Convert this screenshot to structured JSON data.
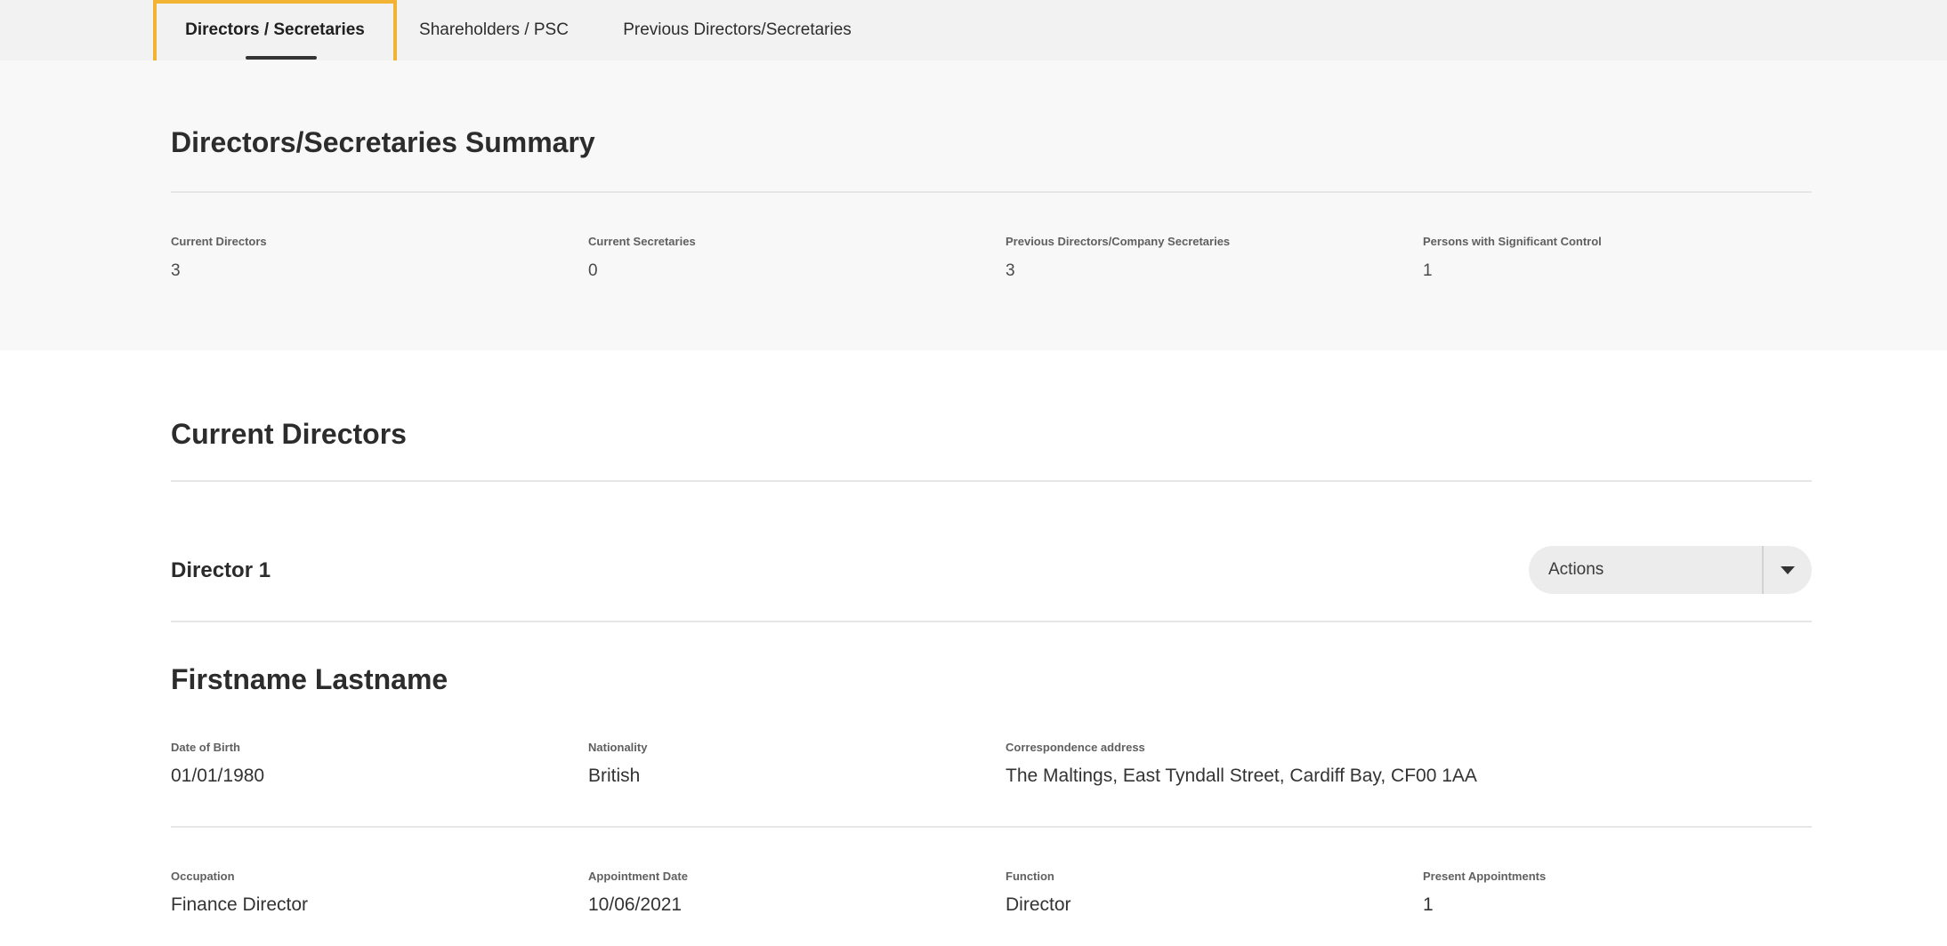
{
  "tabs": [
    {
      "label": "Directors / Secretaries",
      "active": true
    },
    {
      "label": "Shareholders / PSC",
      "active": false
    },
    {
      "label": "Previous Directors/Secretaries",
      "active": false
    }
  ],
  "summary": {
    "title": "Directors/Secretaries Summary",
    "stats": [
      {
        "label": "Current Directors",
        "value": "3"
      },
      {
        "label": "Current Secretaries",
        "value": "0"
      },
      {
        "label": "Previous Directors/Company Secretaries",
        "value": "3"
      },
      {
        "label": "Persons with Significant Control",
        "value": "1"
      }
    ]
  },
  "current_directors": {
    "title": "Current Directors",
    "director": {
      "heading": "Director 1",
      "actions_label": "Actions",
      "name": "Firstname Lastname",
      "fields": {
        "dob": {
          "label": "Date of Birth",
          "value": "01/01/1980"
        },
        "nationality": {
          "label": "Nationality",
          "value": "British"
        },
        "address": {
          "label": "Correspondence address",
          "value": "The Maltings, East Tyndall Street, Cardiff Bay, CF00 1AA"
        },
        "occupation": {
          "label": "Occupation",
          "value": "Finance Director"
        },
        "appointment_date": {
          "label": "Appointment Date",
          "value": "10/06/2021"
        },
        "function": {
          "label": "Function",
          "value": "Director"
        },
        "present_appointments": {
          "label": "Present Appointments",
          "value": "1"
        }
      }
    }
  },
  "colors": {
    "focus_outline": "#f2b232",
    "tab_bar_bg": "#f2f2f2",
    "summary_bg": "#f8f8f8"
  }
}
